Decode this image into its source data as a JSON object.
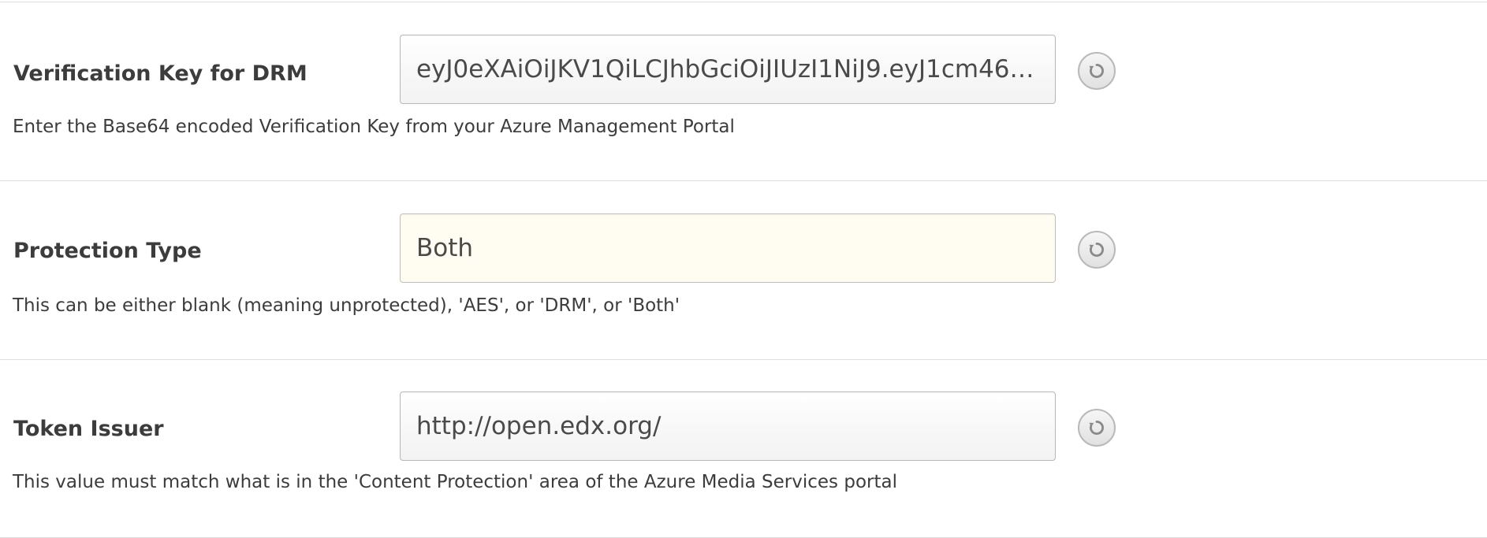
{
  "settings": [
    {
      "label": "Verification Key for DRM",
      "value": "eyJ0eXAiOiJKV1QiLCJhbGciOiJIUzI1NiJ9.eyJ1cm46b…",
      "help": "Enter the Base64 encoded Verification Key from your Azure Management Portal",
      "reset_icon": "reset-icon"
    },
    {
      "label": "Protection Type",
      "value": "Both",
      "help": "This can be either blank (meaning unprotected), 'AES', or 'DRM', or 'Both'",
      "reset_icon": "reset-icon"
    },
    {
      "label": "Token Issuer",
      "value": "http://open.edx.org/",
      "help": "This value must match what is in the 'Content Protection' area of the Azure Media Services portal",
      "reset_icon": "reset-icon"
    }
  ],
  "colors": {
    "modified_field_background": "#fffcf2",
    "divider": "#dedede",
    "text": "#3c3c3c"
  }
}
